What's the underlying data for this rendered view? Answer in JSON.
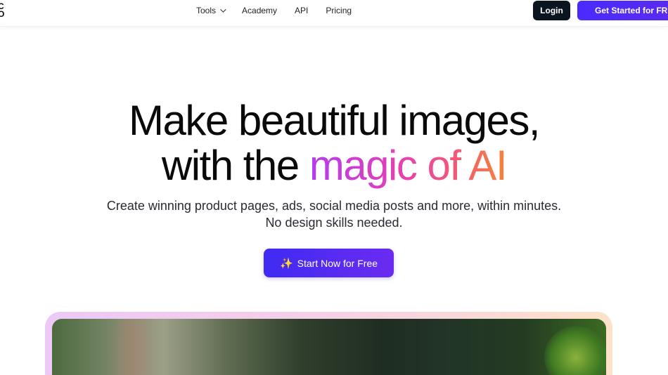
{
  "header": {
    "logo_line1": "C",
    "logo_line2": "O",
    "nav": {
      "tools": "Tools",
      "academy": "Academy",
      "api": "API",
      "pricing": "Pricing"
    },
    "login_label": "Login",
    "get_started_label": "Get Started for FREE"
  },
  "hero": {
    "title_line1": "Make beautiful images,",
    "title_line2_plain": "with the ",
    "title_line2_gradient": "magic of AI",
    "subtitle_line1": "Create winning product pages, ads, social media posts and more, within minutes.",
    "subtitle_line2": "No design skills needed.",
    "cta_label": "Start Now for Free",
    "cta_icon": "sparkle-icon"
  },
  "colors": {
    "primary": "#4a2bff",
    "dark_button": "#0b1520",
    "gradient_start": "#b43cf0",
    "gradient_end": "#f4853a"
  }
}
